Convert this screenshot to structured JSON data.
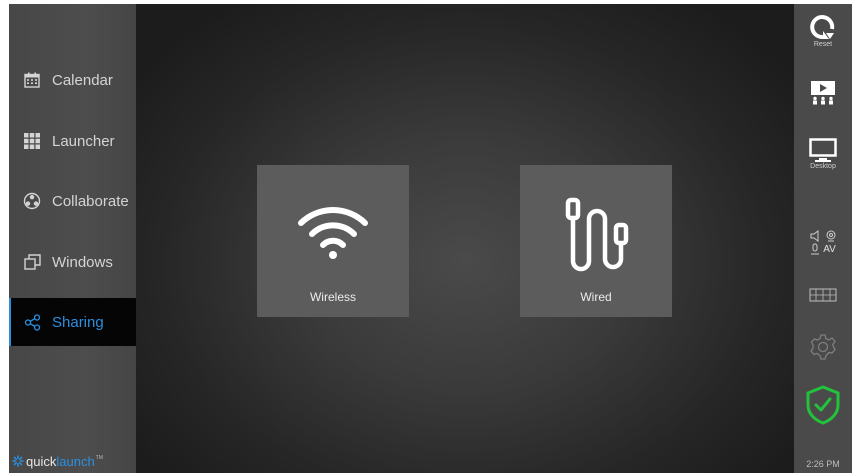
{
  "sidebar": {
    "items": [
      {
        "label": "Calendar",
        "icon": "calendar-icon"
      },
      {
        "label": "Launcher",
        "icon": "grid-icon"
      },
      {
        "label": "Collaborate",
        "icon": "collaborate-icon"
      },
      {
        "label": "Windows",
        "icon": "windows-icon"
      },
      {
        "label": "Sharing",
        "icon": "share-icon",
        "active": true
      }
    ],
    "logo": {
      "part1": "quick",
      "part2": "launch",
      "tm": "TM"
    }
  },
  "main": {
    "tiles": [
      {
        "label": "Wireless",
        "icon": "wifi-icon"
      },
      {
        "label": "Wired",
        "icon": "cable-icon"
      }
    ]
  },
  "rail": {
    "reset_label": "Reset",
    "desktop_label": "Desktop",
    "av_label": "AV",
    "time": "2:26 PM",
    "status": "secure",
    "accent_color": "#2b8fe0",
    "shield_color": "#22c23a"
  }
}
